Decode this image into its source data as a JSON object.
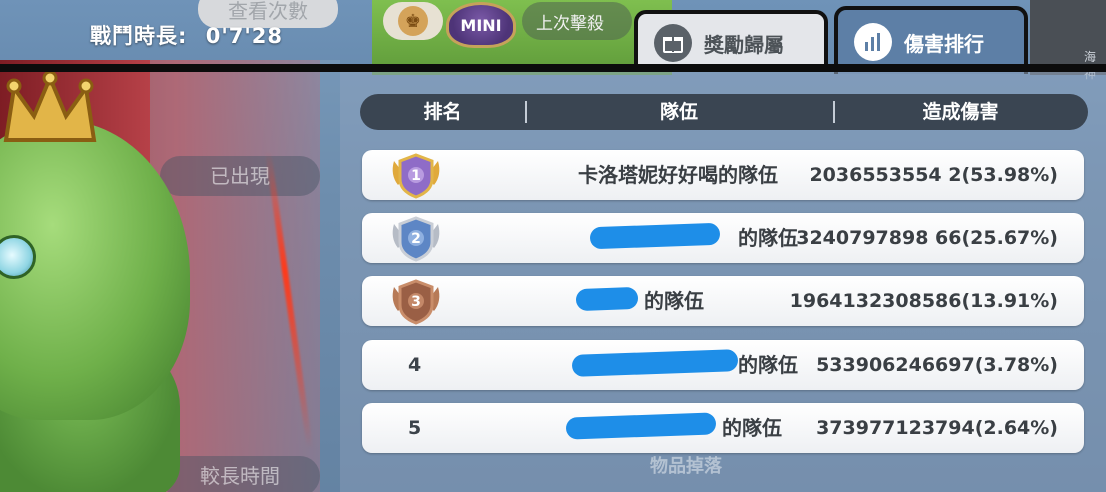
{
  "background": {
    "top_ghost_button": "查看次數",
    "ghost_buttons": [
      "已出現",
      "較長時間"
    ],
    "right_strip_label": "海神",
    "bottom_ghost_text": "物品掉落"
  },
  "top_bar": {
    "battle_time_label": "戰鬥時長:",
    "battle_time_value": "0'7'28",
    "mini_label": "MINI",
    "last_kill_label": "上次擊殺"
  },
  "tabs": [
    {
      "label": "獎勵歸屬",
      "icon": "gift-icon",
      "active": false
    },
    {
      "label": "傷害排行",
      "icon": "bar-chart-icon",
      "active": true
    }
  ],
  "table": {
    "headers": {
      "rank": "排名",
      "team": "隊伍",
      "damage": "造成傷害"
    },
    "rows": [
      {
        "rank": "1",
        "team": "卡洛塔妮好好喝的隊伍",
        "damage": "2036553554 2(53.98%)",
        "damage_text": "2036553554 2(53.98%)",
        "medal": "gold"
      },
      {
        "rank": "2",
        "team": "的隊伍",
        "damage": "3240797898 66(25.67%)",
        "medal": "silver"
      },
      {
        "rank": "3",
        "team": "的隊伍",
        "damage": "1964132308586(13.91%)",
        "medal": "bronze"
      },
      {
        "rank": "4",
        "team": "的隊伍",
        "damage": "533906246697(3.78%)",
        "medal": "none"
      },
      {
        "rank": "5",
        "team": "的隊伍",
        "damage": "373977123794(2.64%)",
        "medal": "none"
      }
    ]
  }
}
